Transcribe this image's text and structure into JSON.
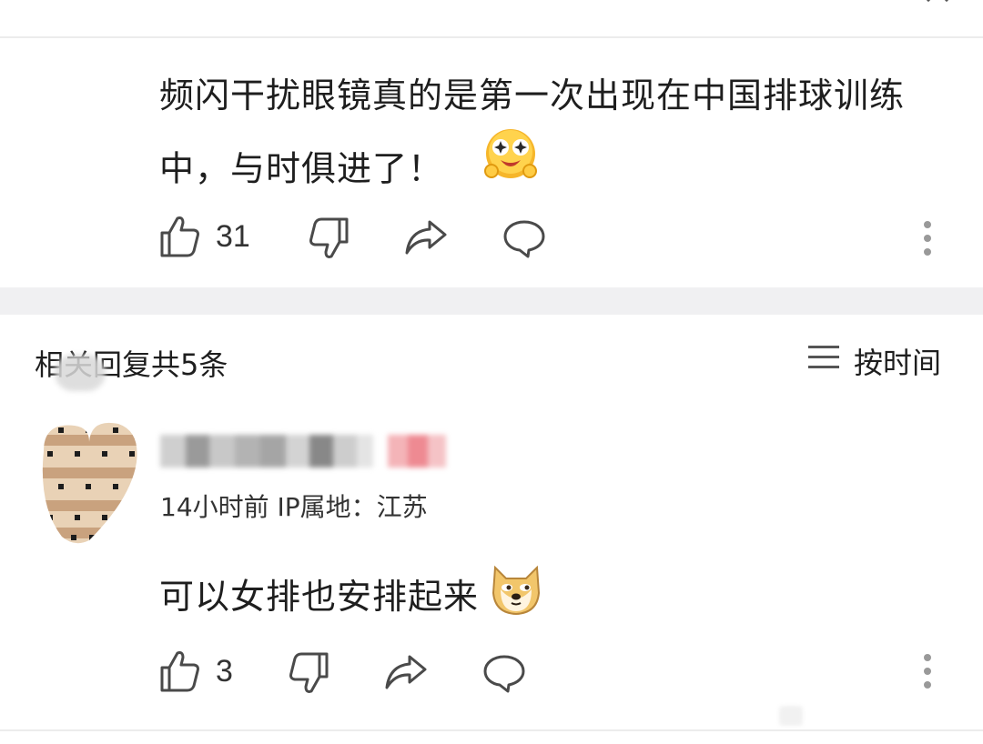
{
  "main_comment": {
    "text": "频闪干扰眼镜真的是第一次出现在中国排球训练中，与时俱进了！",
    "emoji": "star-eyes-face-emoji",
    "like_count": "31"
  },
  "replies_header": {
    "title": "相关回复共5条",
    "sort_label": "按时间"
  },
  "reply": {
    "meta": "14小时前 IP属地：江苏",
    "text": "可以女排也安排起来",
    "emoji": "doge-emoji",
    "like_count": "3"
  },
  "colors": {
    "text": "#1e1e1e",
    "icon": "#4a4a4a",
    "divider": "#ececec",
    "section_bg": "#f0f0f2"
  }
}
